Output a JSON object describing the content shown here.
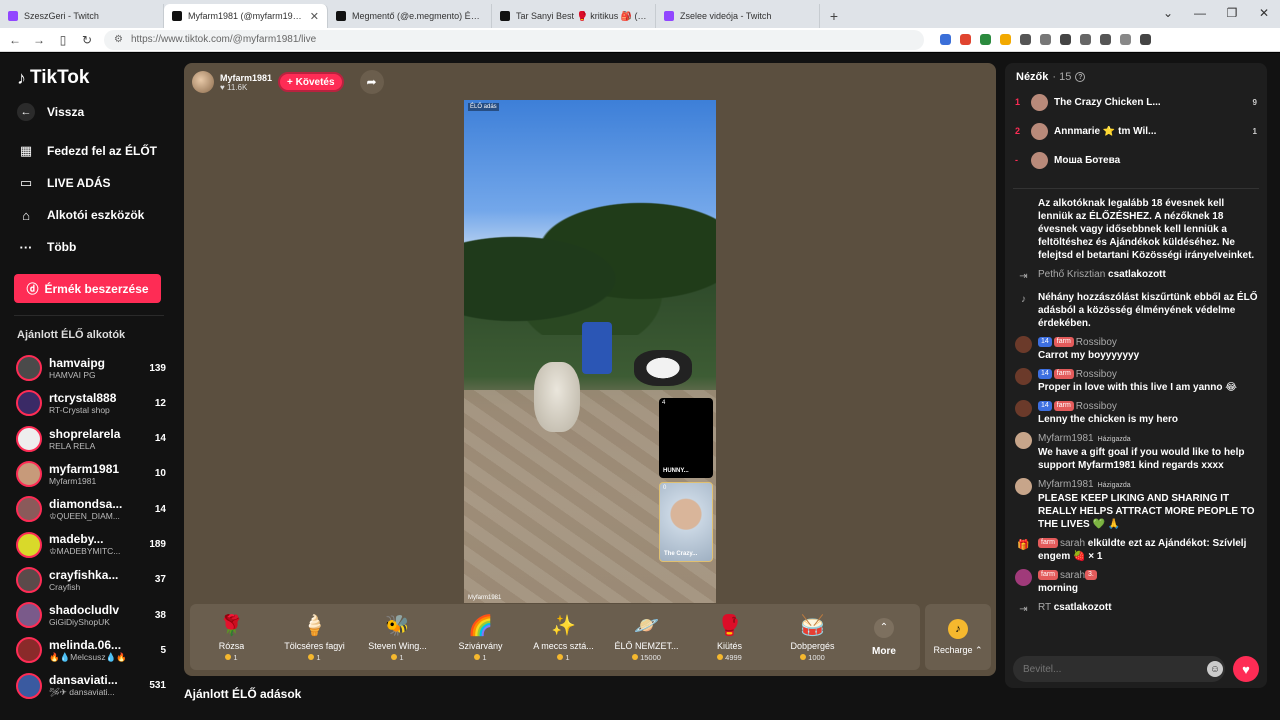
{
  "browser": {
    "tabs": [
      {
        "title": "SzeszGeri - Twitch",
        "color": "#9146ff"
      },
      {
        "title": "Myfarm1981 (@myfarm1981) ÉLŐ",
        "color": "#111111"
      },
      {
        "title": "Megmentő (@e.megmento) ÉLŐ adá",
        "color": "#111111"
      },
      {
        "title": "Tar Sanyi Best 🥊 kritikus 🎒 (@szop",
        "color": "#111111"
      },
      {
        "title": "Zselee videója - Twitch",
        "color": "#9146ff"
      }
    ],
    "url": "https://www.tiktok.com/@myfarm1981/live"
  },
  "sidebar": {
    "brand": "TikTok",
    "back": "Vissza",
    "nav": [
      {
        "label": "Fedezd fel az ÉLŐT",
        "icon": "calendar-icon"
      },
      {
        "label": "LIVE ADÁS",
        "icon": "camera-icon"
      },
      {
        "label": "Alkotói eszközök",
        "icon": "house-icon"
      },
      {
        "label": "Több",
        "icon": "more-icon"
      }
    ],
    "coins_button": "Érmék beszerzése",
    "recommended_title": "Ajánlott ÉLŐ alkotók",
    "creators": [
      {
        "name": "hamvaipg",
        "sub": "HAMVAI PG",
        "count": "139",
        "color": "#4a4a4a"
      },
      {
        "name": "rtcrystal888",
        "sub": "RT-Crystal shop",
        "count": "12",
        "color": "#3a2a66"
      },
      {
        "name": "shoprelarela",
        "sub": "RELA RELA",
        "count": "14",
        "color": "#eeeeee"
      },
      {
        "name": "myfarm1981",
        "sub": "Myfarm1981",
        "count": "10",
        "color": "#c79a7a"
      },
      {
        "name": "diamondsa...",
        "sub": "♔QUEEN_DIAM...",
        "count": "14",
        "color": "#8a5a5a"
      },
      {
        "name": "madeby...",
        "sub": "♔MADEBYMITC...",
        "count": "189",
        "color": "#d9d92a"
      },
      {
        "name": "crayfishka...",
        "sub": "Crayfish",
        "count": "37",
        "color": "#5a4a4a"
      },
      {
        "name": "shadocludlv",
        "sub": "GiGiDiyShopUK",
        "count": "38",
        "color": "#7a5a8a"
      },
      {
        "name": "melinda.06...",
        "sub": "🔥💧Melcsusz💧🔥",
        "count": "5",
        "color": "#8a2a2a"
      },
      {
        "name": "dansaviati...",
        "sub": "🛩✈ dansaviati...",
        "count": "531",
        "color": "#3a5aa0"
      }
    ]
  },
  "stream": {
    "host_name": "Myfarm1981",
    "host_likes": "♥ 11.6K",
    "follow_label": "+ Követés",
    "video_label_top": "ÉLŐ adás",
    "video_label_bottom": "Myfarm1981",
    "guests": [
      {
        "count": "4",
        "name": "HUNNY..."
      },
      {
        "count": "0",
        "name": "The Crazy..."
      }
    ],
    "gifts": [
      {
        "name": "Rózsa",
        "price": "1",
        "icon": "rose-icon",
        "glyph": "🌹"
      },
      {
        "name": "Tölcséres fagyi",
        "price": "1",
        "icon": "ice-cream-icon",
        "glyph": "🍦"
      },
      {
        "name": "Steven Wing...",
        "price": "1",
        "icon": "bee-icon",
        "glyph": "🐝"
      },
      {
        "name": "Szivárvány",
        "price": "1",
        "icon": "rainbow-icon",
        "glyph": "🌈"
      },
      {
        "name": "A meccs sztá...",
        "price": "1",
        "icon": "star-icon",
        "glyph": "✨"
      },
      {
        "name": "ÉLŐ NEMZET...",
        "price": "15000",
        "icon": "planet-icon",
        "glyph": "🪐"
      },
      {
        "name": "Kiütés",
        "price": "4999",
        "icon": "ring-icon",
        "glyph": "🥊"
      },
      {
        "name": "Dobpergés",
        "price": "1000",
        "icon": "drum-icon",
        "glyph": "🥁"
      }
    ],
    "more_label": "More",
    "recharge_label": "Recharge ⌃"
  },
  "recommended_live_title": "Ajánlott ÉLŐ adások",
  "chat": {
    "viewers_label": "Nézők",
    "viewers_count": "· 15",
    "viewers": [
      {
        "rank": "1",
        "name": "The Crazy Chicken L...",
        "score": "9"
      },
      {
        "rank": "2",
        "name": "Annmarie ⭐ tm Wil...",
        "score": "1"
      },
      {
        "rank": "-",
        "name": "Моша Ботева",
        "score": ""
      }
    ],
    "messages": [
      {
        "kind": "sys",
        "text": "Az alkotóknak legalább 18 évesnek kell lenniük az ÉLŐZÉSHEZ. A nézőknek 18 évesnek vagy idősebbnek kell lenniük a feltöltéshez és Ajándékok küldéséhez. Ne felejtsd el betartani Közösségi irányelveinket."
      },
      {
        "kind": "join",
        "user": "Pethő Krisztian",
        "text": "csatlakozott"
      },
      {
        "kind": "sys2",
        "text": "Néhány hozzászólást kiszűrtünk ebből az ÉLŐ adásból a közösség élményének védelme érdekében."
      },
      {
        "kind": "user",
        "lvl": "14",
        "fan": "farm",
        "user": "Rossiboy",
        "text": "Carrot my boyyyyyyy"
      },
      {
        "kind": "user",
        "lvl": "14",
        "fan": "farm",
        "user": "Rossiboy",
        "text": "Proper in love with this live I am yanno 😂"
      },
      {
        "kind": "user",
        "lvl": "14",
        "fan": "farm",
        "user": "Rossiboy",
        "text": "Lenny the chicken is my hero"
      },
      {
        "kind": "host",
        "user": "Myfarm1981",
        "host_tag": "Házigazda",
        "text": "We have a gift goal if you would like to help support Myfarm1981 kind regards xxxx"
      },
      {
        "kind": "host",
        "user": "Myfarm1981",
        "host_tag": "Házigazda",
        "text": "PLEASE KEEP LIKING AND SHARING IT REALLY HELPS ATTRACT MORE PEOPLE TO THE LIVES 💚 🙏"
      },
      {
        "kind": "gift",
        "fan": "farm",
        "user": "sarah",
        "text": "elküldte ezt az Ajándékot: Szívlelj engem 🍓 × 1"
      },
      {
        "kind": "user2",
        "fan": "farm",
        "user": "sarah",
        "lvl": "3.",
        "text": "morning"
      },
      {
        "kind": "join",
        "user": "RT",
        "text": "csatlakozott"
      }
    ],
    "input_placeholder": "Bevitel..."
  }
}
